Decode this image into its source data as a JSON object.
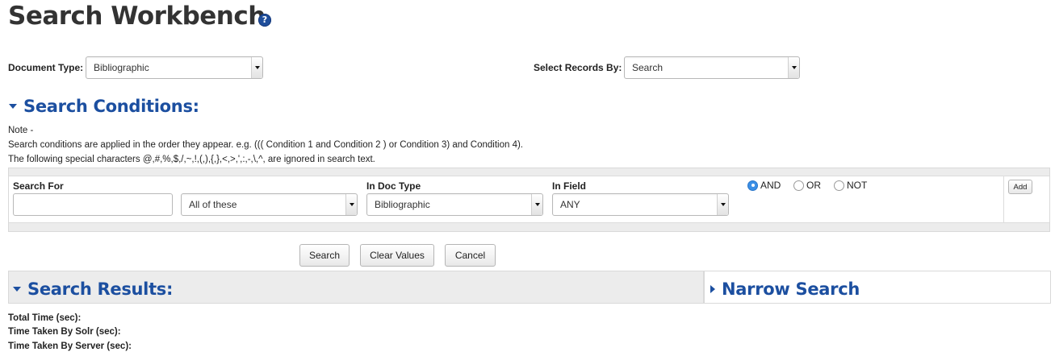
{
  "page": {
    "title": "Search Workbench",
    "help_icon": "question-icon"
  },
  "top_filters": {
    "document_type_label": "Document Type:",
    "document_type_value": "Bibliographic",
    "select_records_label": "Select Records By:",
    "select_records_value": "Search"
  },
  "search_conditions": {
    "heading": "Search Conditions:",
    "note_title": "Note -",
    "note_line1": "Search conditions are applied in the order they appear. e.g. ((( Condition 1 and Condition 2 ) or Condition 3) and Condition 4).",
    "note_line2": "The following special characters @,#,%,$,/,~,!,(,),{,},<,>,',:,-,\\,^, are ignored in search text.",
    "columns": {
      "search_for": "Search For",
      "in_doc_type": "In Doc Type",
      "in_field": "In Field"
    },
    "row": {
      "search_text": "",
      "match_option": "All of these",
      "doc_type": "Bibliographic",
      "field": "ANY"
    },
    "operators": {
      "and": "AND",
      "or": "OR",
      "not": "NOT",
      "selected": "AND"
    },
    "add_label": "Add"
  },
  "actions": {
    "search": "Search",
    "clear": "Clear Values",
    "cancel": "Cancel"
  },
  "results": {
    "heading": "Search Results:",
    "narrow_heading": "Narrow Search",
    "total_time_label": "Total Time (sec):",
    "solr_time_label": "Time Taken By Solr (sec):",
    "server_time_label": "Time Taken By Server (sec):"
  },
  "colors": {
    "accent": "#1c4fa0",
    "panel": "#ececec",
    "radio_selected": "#3b8fe6"
  }
}
